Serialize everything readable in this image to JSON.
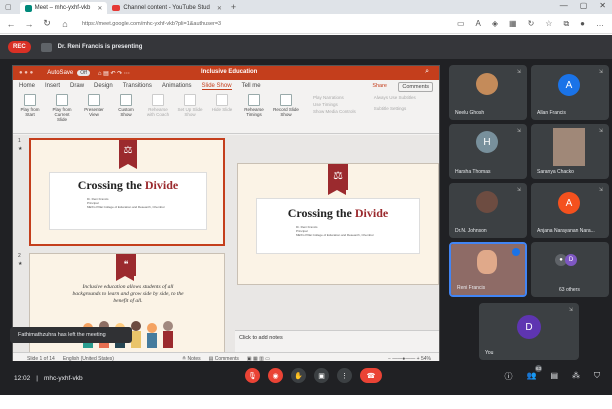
{
  "browser": {
    "tabs": [
      {
        "label": "Meet – mhc-yxhf-vkb",
        "active": true
      },
      {
        "label": "Channel content - YouTube Stud",
        "active": false
      }
    ],
    "url": "https://meet.google.com/mhc-yxhf-vkb?pli=1&authuser=3"
  },
  "meet": {
    "rec_label": "REC",
    "presenting_text": "Dr. Reni Francis is presenting",
    "meeting_code": "mhc-yxhf-vkb",
    "time": "12:02",
    "notification": "Fathimathzuhra has left the meeting"
  },
  "ppt": {
    "autosave": "AutoSave",
    "autosave_state": "Off",
    "doc_title": "Inclusive Education",
    "menu": [
      "Home",
      "Insert",
      "Draw",
      "Design",
      "Transitions",
      "Animations",
      "Slide Show",
      "Tell me"
    ],
    "active_menu": "Slide Show",
    "share": "Share",
    "comments": "Comments",
    "ribbon": [
      {
        "label": "Play from Start",
        "dim": false
      },
      {
        "label": "Play from Current Slide",
        "dim": false
      },
      {
        "label": "Presenter View",
        "dim": false
      },
      {
        "label": "Custom Show",
        "dim": false
      },
      {
        "label": "Rehearse with Coach",
        "dim": true
      },
      {
        "label": "Set Up Slide Show",
        "dim": true
      },
      {
        "label": "Hide Slide",
        "dim": true
      },
      {
        "label": "Rehearse Timings",
        "dim": false
      },
      {
        "label": "Record Slide Show",
        "dim": false
      }
    ],
    "ribbon_checks": [
      "Play Narrations",
      "Use Timings",
      "Show Media Controls"
    ],
    "ribbon_right": [
      "Always Use Subtitles",
      "Subtitle Settings"
    ],
    "slide_title_plain": "Crossing the ",
    "slide_title_accent": "Divide",
    "slide_author_lines": [
      "Dr. Reni Francis",
      "Principal",
      "MES's Pillai College of Education and Research, Chembur"
    ],
    "slide2_quote": "Inclusive education allows students of all backgrounds to learn and grow side by side, to the benefit of all.",
    "slide_numbers": [
      "1",
      "2"
    ],
    "notes_placeholder": "Click to add notes",
    "status_slide": "Slide 1 of 14",
    "status_lang": "English (United States)",
    "status_notes": "Notes",
    "status_comments": "Comments",
    "zoom": "54%"
  },
  "participants": [
    {
      "name": "Neelu Ghosh",
      "type": "photo"
    },
    {
      "name": "Allan Francis",
      "type": "avatar",
      "initial": "A",
      "color": "#1a73e8"
    },
    {
      "name": "Harsha Thomas",
      "type": "avatar",
      "initial": "H",
      "color": "#78909c"
    },
    {
      "name": "Saranya Chacko",
      "type": "photo"
    },
    {
      "name": "Dr.N. Johnson",
      "type": "photo"
    },
    {
      "name": "Anjana Narayanan Nara...",
      "type": "avatar",
      "initial": "A",
      "color": "#f4511e"
    },
    {
      "name": "Reni Francis",
      "type": "video"
    },
    {
      "name": "63 others",
      "type": "others",
      "initial": "D"
    },
    {
      "name": "You",
      "type": "avatar",
      "initial": "D",
      "color": "#5e35b1"
    }
  ],
  "others_badge": "63"
}
